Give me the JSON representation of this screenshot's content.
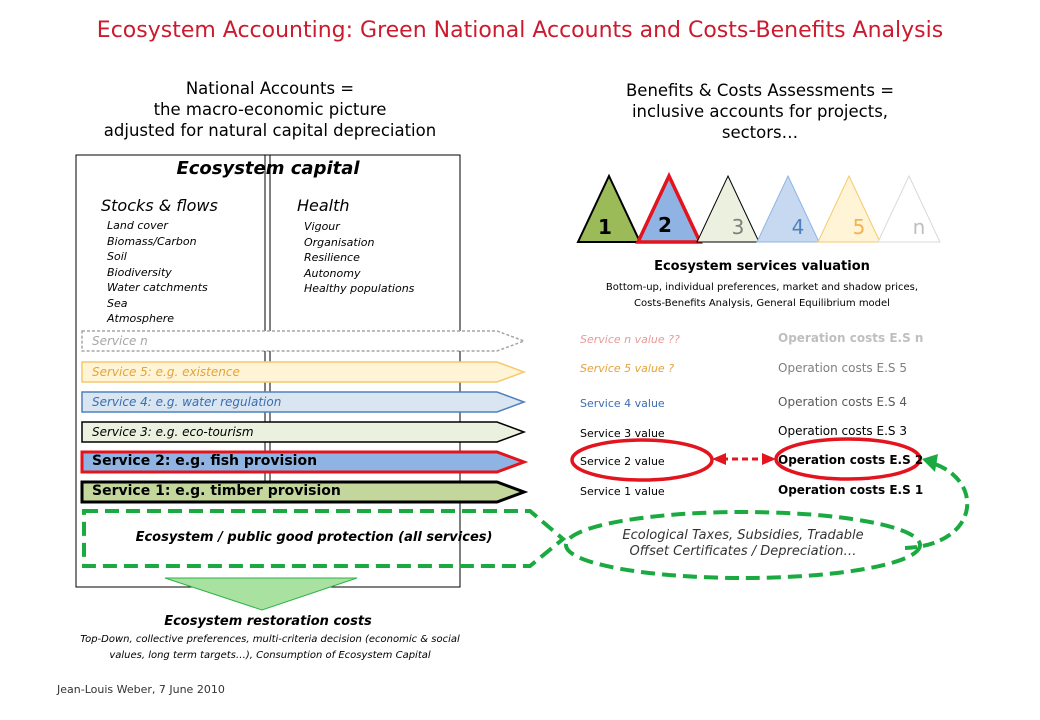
{
  "title": "Ecosystem Accounting: Green National Accounts and Costs-Benefits Analysis",
  "left_heading": [
    "National Accounts =",
    "the macro-economic picture",
    "adjusted for natural capital depreciation"
  ],
  "right_heading": [
    "Benefits & Costs Assessments =",
    "inclusive accounts for projects,",
    "sectors…"
  ],
  "ecosystem_capital": {
    "title": "Ecosystem capital",
    "stocks_title": "Stocks & flows",
    "stocks": [
      "Land cover",
      "Biomass/Carbon",
      "Soil",
      "Biodiversity",
      "Water catchments",
      "Sea",
      "Atmosphere"
    ],
    "health_title": "Health",
    "health": [
      "Vigour",
      "Organisation",
      "Resilience",
      "Autonomy",
      "Healthy populations"
    ]
  },
  "services": [
    {
      "label": "Service n",
      "fill": "#ffffff",
      "stroke": "#a6a6a6",
      "text": "#a6a6a6"
    },
    {
      "label": "Service 5: e.g. existence",
      "fill": "#fff5d6",
      "stroke": "#f5c96e",
      "text": "#e4a23a"
    },
    {
      "label": "Service 4: e.g. water regulation",
      "fill": "#dae5f2",
      "stroke": "#4f81bd",
      "text": "#3b6db0"
    },
    {
      "label": "Service 3: e.g. eco-tourism",
      "fill": "#ebf1de",
      "stroke": "#000000",
      "text": "#000000"
    },
    {
      "label": "Service 2: e.g. fish provision",
      "fill": "#8fb4e3",
      "stroke": "#e3141e",
      "text": "#000000"
    },
    {
      "label": "Service 1: e.g. timber provision",
      "fill": "#c3d69b",
      "stroke": "#000000",
      "text": "#000000"
    }
  ],
  "protection_label": "Ecosystem / public good protection (all services)",
  "restoration": {
    "title": "Ecosystem restoration costs",
    "desc1": "Top-Down, collective preferences, multi-criteria decision (economic & social",
    "desc2": "values, long term targets…), Consumption of Ecosystem Capital"
  },
  "triangles": [
    {
      "label": "1",
      "fill": "#9bbb59",
      "stroke": "#000000",
      "text": "#000000"
    },
    {
      "label": "2",
      "fill": "#8fb4e3",
      "stroke": "#e3141e",
      "text": "#000000"
    },
    {
      "label": "3",
      "fill": "#ebf1de",
      "stroke": "#000000",
      "text": "#7f7f7f"
    },
    {
      "label": "4",
      "fill": "#c6d9f1",
      "stroke": "#8fb4e3",
      "text": "#4f81bd"
    },
    {
      "label": "5",
      "fill": "#fff5d6",
      "stroke": "#f5c96e",
      "text": "#f5b24e"
    },
    {
      "label": "n",
      "fill": "#ffffff",
      "stroke": "#d9d9d9",
      "text": "#bfbfbf"
    }
  ],
  "valuation": {
    "title": "Ecosystem services valuation",
    "desc1": "Bottom-up, individual preferences, market and shadow prices,",
    "desc2": "Costs-Benefits Analysis, General Equilibrium model"
  },
  "values": [
    {
      "label": "Service n value ??",
      "color": "#e89a9a"
    },
    {
      "label": "Service 5 value ?",
      "color": "#e4a23a"
    },
    {
      "label": "Service 4 value",
      "color": "#3b6db0"
    },
    {
      "label": "Service 3 value",
      "color": "#000000"
    },
    {
      "label": "Service 2 value",
      "color": "#000000"
    },
    {
      "label": "Service 1 value",
      "color": "#000000"
    }
  ],
  "op_costs": [
    {
      "label": "Operation costs E.S n",
      "color": "#bfbfbf"
    },
    {
      "label": "Operation costs E.S 5",
      "color": "#7f7f7f"
    },
    {
      "label": "Operation costs E.S 4",
      "color": "#595959"
    },
    {
      "label": "Operation costs E.S 3",
      "color": "#000000"
    },
    {
      "label": "Operation costs E.S 2",
      "color": "#000000"
    },
    {
      "label": "Operation costs E.S 1",
      "color": "#000000"
    }
  ],
  "taxes": [
    "Ecological Taxes, Subsidies, Tradable",
    "Offset Certificates / Depreciation…"
  ],
  "footer": "Jean-Louis Weber, 7 June 2010"
}
